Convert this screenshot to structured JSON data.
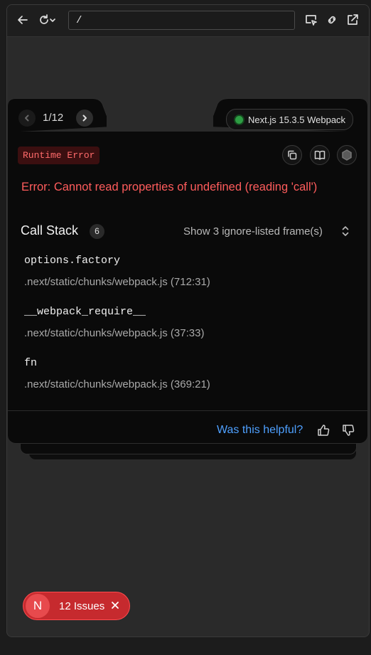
{
  "browser": {
    "url": "/"
  },
  "overlay": {
    "pager": {
      "current": "1",
      "total": "12",
      "text": "1/12"
    },
    "version": "Next.js 15.3.5 Webpack",
    "error_type": "Runtime Error",
    "error_message": "Error: Cannot read properties of undefined (reading 'call')",
    "call_stack": {
      "title": "Call Stack",
      "count": "6",
      "ignore_toggle": "Show 3 ignore-listed frame(s)",
      "frames": [
        {
          "fn": "options.factory",
          "location": ".next/static/chunks/webpack.js (712:31)"
        },
        {
          "fn": "__webpack_require__",
          "location": ".next/static/chunks/webpack.js (37:33)"
        },
        {
          "fn": "fn",
          "location": ".next/static/chunks/webpack.js (369:21)"
        }
      ]
    },
    "feedback": {
      "question": "Was this helpful?"
    }
  },
  "issues_badge": {
    "logo_letter": "N",
    "label": "12 Issues"
  },
  "colors": {
    "error_red": "#ff5c5c",
    "link_blue": "#4ea0ff",
    "status_green": "#2d9d43",
    "badge_red": "#c62a2e"
  }
}
